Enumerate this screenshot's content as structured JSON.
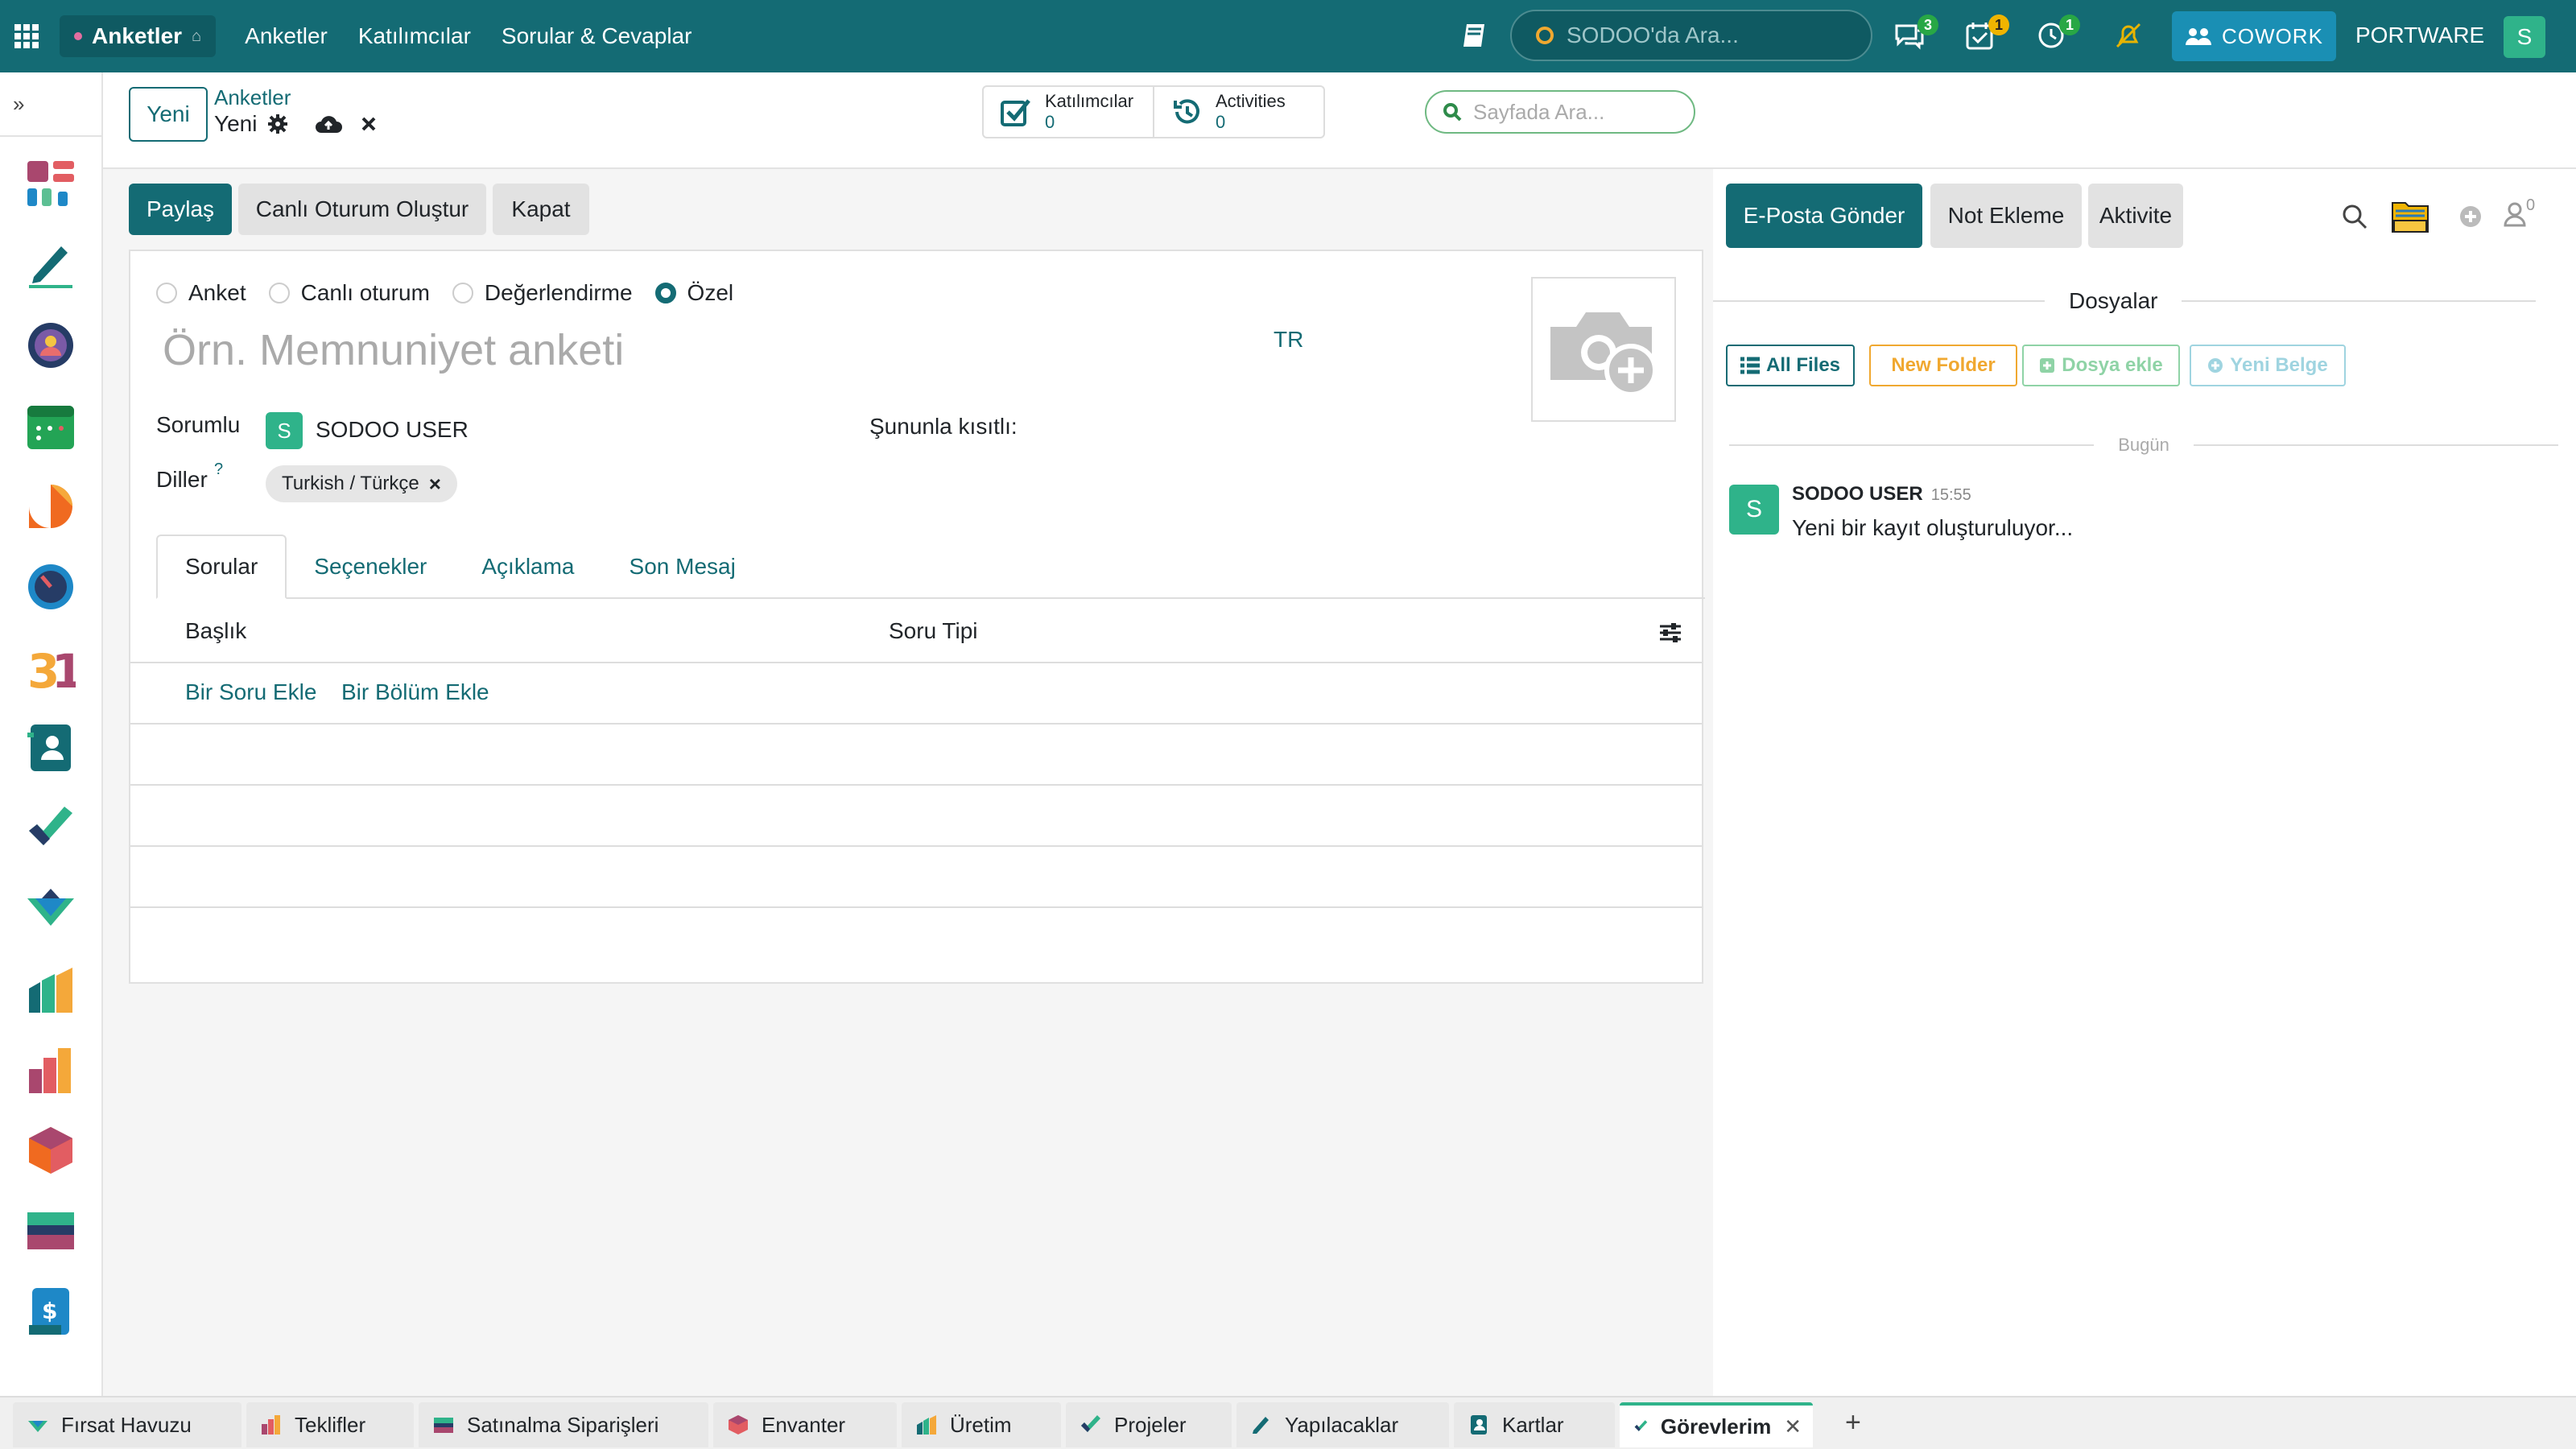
{
  "topbar": {
    "app_name": "Anketler",
    "nav": [
      "Anketler",
      "Katılımcılar",
      "Sorular & Cevaplar"
    ],
    "search_placeholder": "SODOO'da Ara...",
    "badges": {
      "messages": "3",
      "calendar": "1",
      "activities": "1"
    },
    "cowork_label": "COWORK",
    "company": "PORTWARE",
    "user_initial": "S"
  },
  "control": {
    "new_button": "Yeni",
    "breadcrumb_parent": "Anketler",
    "breadcrumb_current": "Yeni",
    "stats": [
      {
        "label": "Katılımcılar",
        "value": "0"
      },
      {
        "label": "Activities",
        "value": "0"
      }
    ],
    "page_search_placeholder": "Sayfada Ara..."
  },
  "actions": {
    "share": "Paylaş",
    "live_session": "Canlı Oturum Oluştur",
    "close": "Kapat"
  },
  "form": {
    "types": [
      {
        "label": "Anket",
        "selected": false
      },
      {
        "label": "Canlı oturum",
        "selected": false
      },
      {
        "label": "Değerlendirme",
        "selected": false
      },
      {
        "label": "Özel",
        "selected": true
      }
    ],
    "title_placeholder": "Örn. Memnuniyet anketi",
    "lang_code": "TR",
    "responsible_label": "Sorumlu",
    "responsible_value": "SODOO USER",
    "responsible_initial": "S",
    "restricted_label": "Şununla kısıtlı:",
    "languages_label": "Diller",
    "languages_help": "?",
    "language_tag": "Turkish / Türkçe",
    "tabs": [
      "Sorular",
      "Seçenekler",
      "Açıklama",
      "Son Mesaj"
    ],
    "table_headers": [
      "Başlık",
      "Soru Tipi"
    ],
    "add_question": "Bir Soru Ekle",
    "add_section": "Bir Bölüm Ekle"
  },
  "chatter": {
    "send_email": "E-Posta Gönder",
    "add_note": "Not Ekleme",
    "activity": "Aktivite",
    "follower_count": "0",
    "files_heading": "Dosyalar",
    "file_buttons": [
      "All Files",
      "New Folder",
      "Dosya ekle",
      "Yeni Belge"
    ],
    "date_separator": "Bugün",
    "message": {
      "author": "SODOO USER",
      "time": "15:55",
      "body": "Yeni bir kayıt oluşturuluyor...",
      "initial": "S"
    }
  },
  "bottom_tabs": [
    "Fırsat Havuzu",
    "Teklifler",
    "Satınalma Siparişleri",
    "Envanter",
    "Üretim",
    "Projeler",
    "Yapılacaklar",
    "Kartlar",
    "Görevlerim"
  ],
  "bottom_active": "Görevlerim",
  "colors": {
    "primary": "#146b74",
    "green": "#2fb38a",
    "badge_green": "#28a745",
    "badge_yellow": "#f0b400",
    "cowork": "#1a8fb4"
  }
}
